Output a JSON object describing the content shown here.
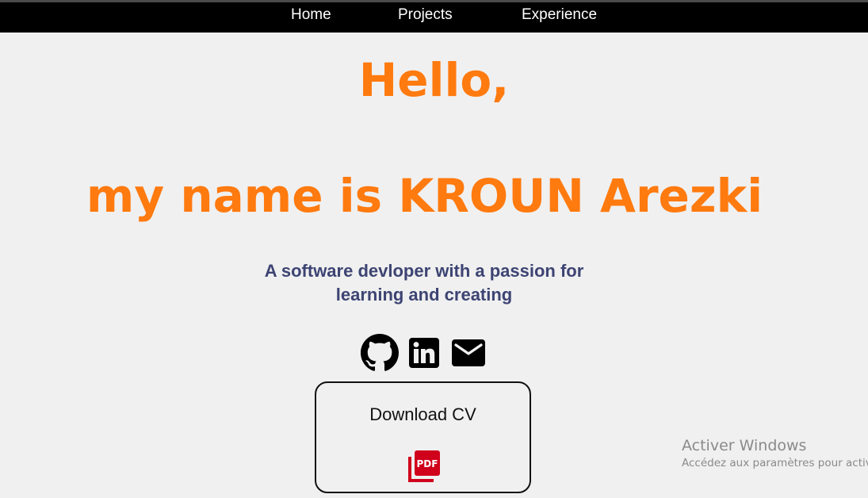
{
  "nav": {
    "home": "Home",
    "projects": "Projects",
    "experience": "Experience"
  },
  "hero": {
    "greeting": "Hello,",
    "name_line": "my name is KROUN Arezki",
    "tagline_line1": "A software devloper with a passion for",
    "tagline_line2": "learning and creating"
  },
  "social": {
    "icons": [
      "github-icon",
      "linkedin-icon",
      "email-icon"
    ]
  },
  "cv": {
    "label": "Download CV",
    "icon": "pdf-icon",
    "icon_text": "PDF"
  },
  "watermark": {
    "title": "Activer Windows",
    "subtitle": "Accédez aux paramètres pour activer"
  },
  "colors": {
    "accent": "#ff7a0f",
    "tagline": "#3d4473",
    "navbar": "#000000",
    "background": "#f0f0f0",
    "pdf_red": "#d0021b"
  }
}
